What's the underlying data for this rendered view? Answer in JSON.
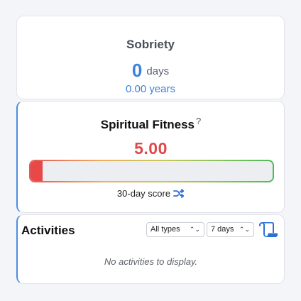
{
  "sobriety": {
    "title": "Sobriety",
    "days_value": "0",
    "days_unit": "days",
    "years": "0.00 years"
  },
  "fitness": {
    "title": "Spiritual Fitness",
    "help_icon": "?",
    "score": "5.00",
    "score_fraction": 0.05,
    "subtitle": "30-day score",
    "shuffle_icon": "shuffle-icon",
    "score_color": "#e04848"
  },
  "activities": {
    "title": "Activities",
    "type_filter": "All types",
    "range_filter": "7 days",
    "empty_message": "No activities to display.",
    "scroll_icon": "scroll-icon"
  },
  "colors": {
    "accent": "#3b82e0",
    "danger": "#e04848"
  }
}
